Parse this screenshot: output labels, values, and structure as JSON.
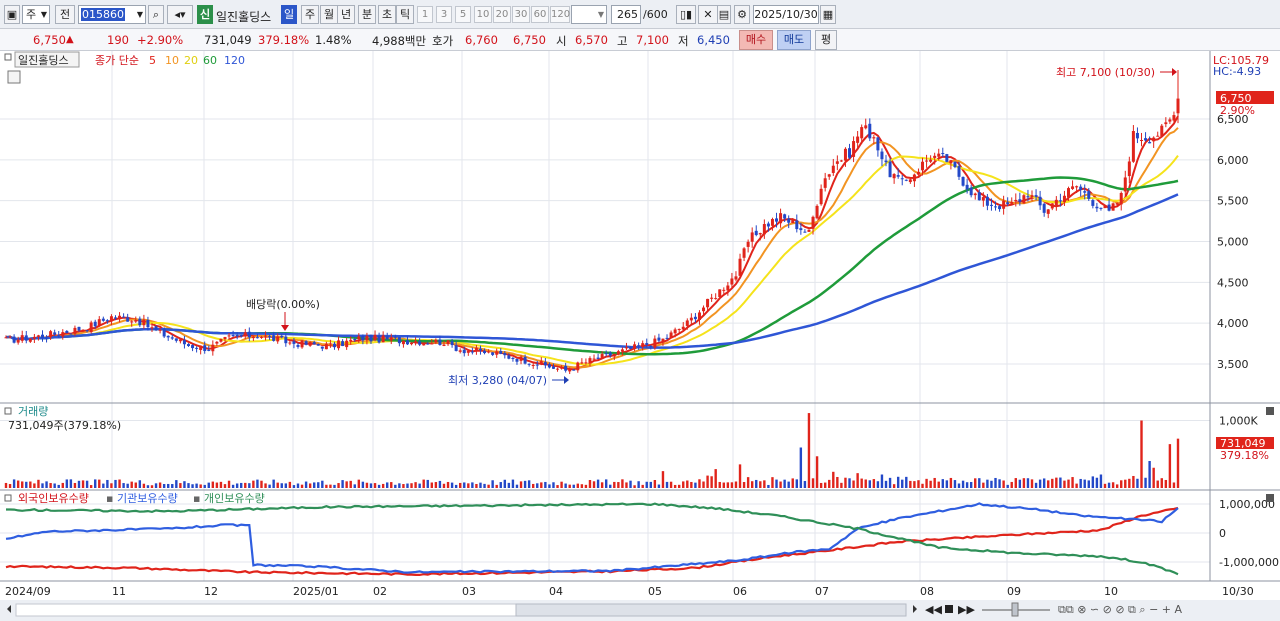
{
  "toolbar": {
    "market": "주",
    "prev": "전",
    "code": "015860",
    "name": "일진홀딩스",
    "credit_badge": "신",
    "periods": [
      "일",
      "주",
      "월",
      "년",
      "분",
      "초",
      "틱"
    ],
    "minute_options": [
      "1",
      "3",
      "5",
      "10",
      "20",
      "30",
      "60",
      "120"
    ],
    "count": "265",
    "count_max": "/600",
    "date": "2025/10/30"
  },
  "quote": {
    "price": "6,750",
    "arrow": "▲",
    "change": "190",
    "change_pct": "+2.90%",
    "volume": "731,049",
    "volume_ratio": "379.18%",
    "turnover": "1.48%",
    "amount": "4,988백만",
    "bid_label": "호가",
    "bid1": "6,760",
    "bid2": "6,750",
    "open_label": "시",
    "open": "6,570",
    "high_label": "고",
    "high": "7,100",
    "low_label": "저",
    "low": "6,450",
    "buy_button": "매수",
    "sell_button": "매도",
    "eval_button": "평"
  },
  "price_panel": {
    "title": "일진홀딩스",
    "ma_label": "종가 단순",
    "ma_periods": [
      "5",
      "10",
      "20",
      "60",
      "120"
    ],
    "lc": "LC:105.79",
    "hc": "HC:-4.93",
    "last_price_tag": "6,750",
    "last_pct_tag": "2.90%",
    "high_annotation": "최고 7,100 (10/30)",
    "low_annotation": "최저 3,280 (04/07)",
    "dividend_annotation": "배당락(0.00%)"
  },
  "volume_panel": {
    "title": "거래량",
    "value_text": "731,049주(379.18%)",
    "last_tag": "731,049",
    "last_pct": "379.18%"
  },
  "holdings_panel": {
    "labels": [
      "외국인보유수량",
      "기관보유수량",
      "개인보유수량"
    ]
  },
  "colors": {
    "up": "#e0241b",
    "down": "#2348c8",
    "ma5": "#e0241b",
    "ma10": "#f29422",
    "ma20": "#f5e31b",
    "ma60": "#1f9b3a",
    "ma120": "#2f56d6",
    "foreign": "#e0241b",
    "institution": "#2f5ee0",
    "individual": "#2f8f58"
  },
  "chart_data": [
    {
      "type": "candlestick",
      "title": "일진홀딩스",
      "x_ticks": [
        "2024/09",
        "11",
        "12",
        "2025/01",
        "02",
        "03",
        "04",
        "05",
        "06",
        "07",
        "08",
        "09",
        "10",
        "10/30"
      ],
      "ylim": [
        3000,
        7200
      ],
      "y_ticks": [
        3500,
        4000,
        4500,
        5000,
        5500,
        6000,
        6500
      ],
      "y_tick_labels": [
        "3,500",
        "4,000",
        "4,500",
        "5,000",
        "5,500",
        "6,000",
        "6,500"
      ],
      "close_anchors": [
        [
          0,
          3790
        ],
        [
          10,
          3850
        ],
        [
          20,
          3950
        ],
        [
          26,
          4080
        ],
        [
          32,
          4050
        ],
        [
          38,
          3880
        ],
        [
          45,
          3730
        ],
        [
          50,
          3690
        ],
        [
          55,
          3820
        ],
        [
          62,
          3860
        ],
        [
          70,
          3760
        ],
        [
          80,
          3720
        ],
        [
          88,
          3820
        ],
        [
          98,
          3790
        ],
        [
          108,
          3770
        ],
        [
          112,
          3680
        ],
        [
          120,
          3630
        ],
        [
          127,
          3560
        ],
        [
          133,
          3480
        ],
        [
          138,
          3420
        ],
        [
          142,
          3510
        ],
        [
          148,
          3600
        ],
        [
          155,
          3700
        ],
        [
          162,
          3800
        ],
        [
          168,
          4000
        ],
        [
          175,
          4350
        ],
        [
          180,
          4600
        ],
        [
          183,
          5000
        ],
        [
          187,
          5200
        ],
        [
          191,
          5300
        ],
        [
          195,
          5200
        ],
        [
          198,
          5100
        ],
        [
          201,
          5700
        ],
        [
          204,
          5950
        ],
        [
          208,
          6100
        ],
        [
          211,
          6400
        ],
        [
          214,
          6300
        ],
        [
          217,
          5900
        ],
        [
          221,
          5700
        ],
        [
          224,
          5850
        ],
        [
          228,
          6050
        ],
        [
          232,
          6000
        ],
        [
          236,
          5750
        ],
        [
          240,
          5500
        ],
        [
          244,
          5450
        ],
        [
          248,
          5450
        ],
        [
          252,
          5600
        ],
        [
          256,
          5380
        ],
        [
          260,
          5550
        ],
        [
          264,
          5680
        ],
        [
          268,
          5500
        ],
        [
          272,
          5350
        ],
        [
          275,
          5550
        ],
        [
          278,
          6300
        ],
        [
          282,
          6280
        ],
        [
          285,
          6350
        ],
        [
          288,
          6550
        ]
      ],
      "last_candle": {
        "open": 6570,
        "high": 7100,
        "low": 6450,
        "close": 6750
      },
      "moving_averages": [
        "5",
        "10",
        "20",
        "60",
        "120"
      ],
      "annotations": [
        "최고 7,100 (10/30)",
        "최저 3,280 (04/07)",
        "배당락(0.00%)"
      ]
    },
    {
      "type": "bar",
      "title": "거래량",
      "ylim": [
        0,
        1200000
      ],
      "y_ticks": [
        1000000
      ],
      "y_tick_labels": [
        "1,000K"
      ],
      "last_value": 731049,
      "spikes": [
        [
          162,
          250000
        ],
        [
          175,
          280000
        ],
        [
          181,
          350000
        ],
        [
          196,
          600000
        ],
        [
          198,
          1110000
        ],
        [
          200,
          470000
        ],
        [
          204,
          240000
        ],
        [
          210,
          220000
        ],
        [
          216,
          200000
        ],
        [
          270,
          200000
        ],
        [
          280,
          1000000
        ],
        [
          282,
          400000
        ],
        [
          283,
          300000
        ],
        [
          287,
          650000
        ],
        [
          289,
          731049
        ]
      ]
    },
    {
      "type": "line",
      "title": "외국인보유수량 / 기관보유수량 / 개인보유수량",
      "ylim": [
        -1500000,
        1200000
      ],
      "y_ticks": [
        1000000,
        0,
        -1000000
      ],
      "y_tick_labels": [
        "1,000,000",
        "0",
        "-1,000,000"
      ],
      "series": [
        {
          "name": "외국인보유수량",
          "anchors": [
            [
              0,
              -1150000
            ],
            [
              30,
              -1200000
            ],
            [
              60,
              -1350000
            ],
            [
              100,
              -1420000
            ],
            [
              150,
              -1320000
            ],
            [
              170,
              -1200000
            ],
            [
              190,
              -800000
            ],
            [
              200,
              -650000
            ],
            [
              220,
              -300000
            ],
            [
              250,
              -50000
            ],
            [
              270,
              100000
            ],
            [
              280,
              600000
            ],
            [
              289,
              850000
            ]
          ]
        },
        {
          "name": "기관보유수량",
          "anchors": [
            [
              0,
              -200000
            ],
            [
              10,
              50000
            ],
            [
              40,
              150000
            ],
            [
              55,
              280000
            ],
            [
              60,
              250000
            ],
            [
              61,
              -1100000
            ],
            [
              75,
              -1150000
            ],
            [
              100,
              -1350000
            ],
            [
              150,
              -1300000
            ],
            [
              180,
              -950000
            ],
            [
              195,
              -650000
            ],
            [
              203,
              -550000
            ],
            [
              210,
              150000
            ],
            [
              220,
              500000
            ],
            [
              240,
              1000000
            ],
            [
              255,
              800000
            ],
            [
              265,
              600000
            ],
            [
              280,
              450000
            ],
            [
              285,
              400000
            ],
            [
              289,
              850000
            ]
          ]
        },
        {
          "name": "개인보유수량",
          "anchors": [
            [
              0,
              800000
            ],
            [
              40,
              750000
            ],
            [
              80,
              900000
            ],
            [
              120,
              950000
            ],
            [
              160,
              1000000
            ],
            [
              175,
              850000
            ],
            [
              190,
              600000
            ],
            [
              210,
              150000
            ],
            [
              230,
              -500000
            ],
            [
              250,
              -700000
            ],
            [
              270,
              -800000
            ],
            [
              280,
              -1000000
            ],
            [
              289,
              -1400000
            ]
          ]
        }
      ]
    }
  ]
}
